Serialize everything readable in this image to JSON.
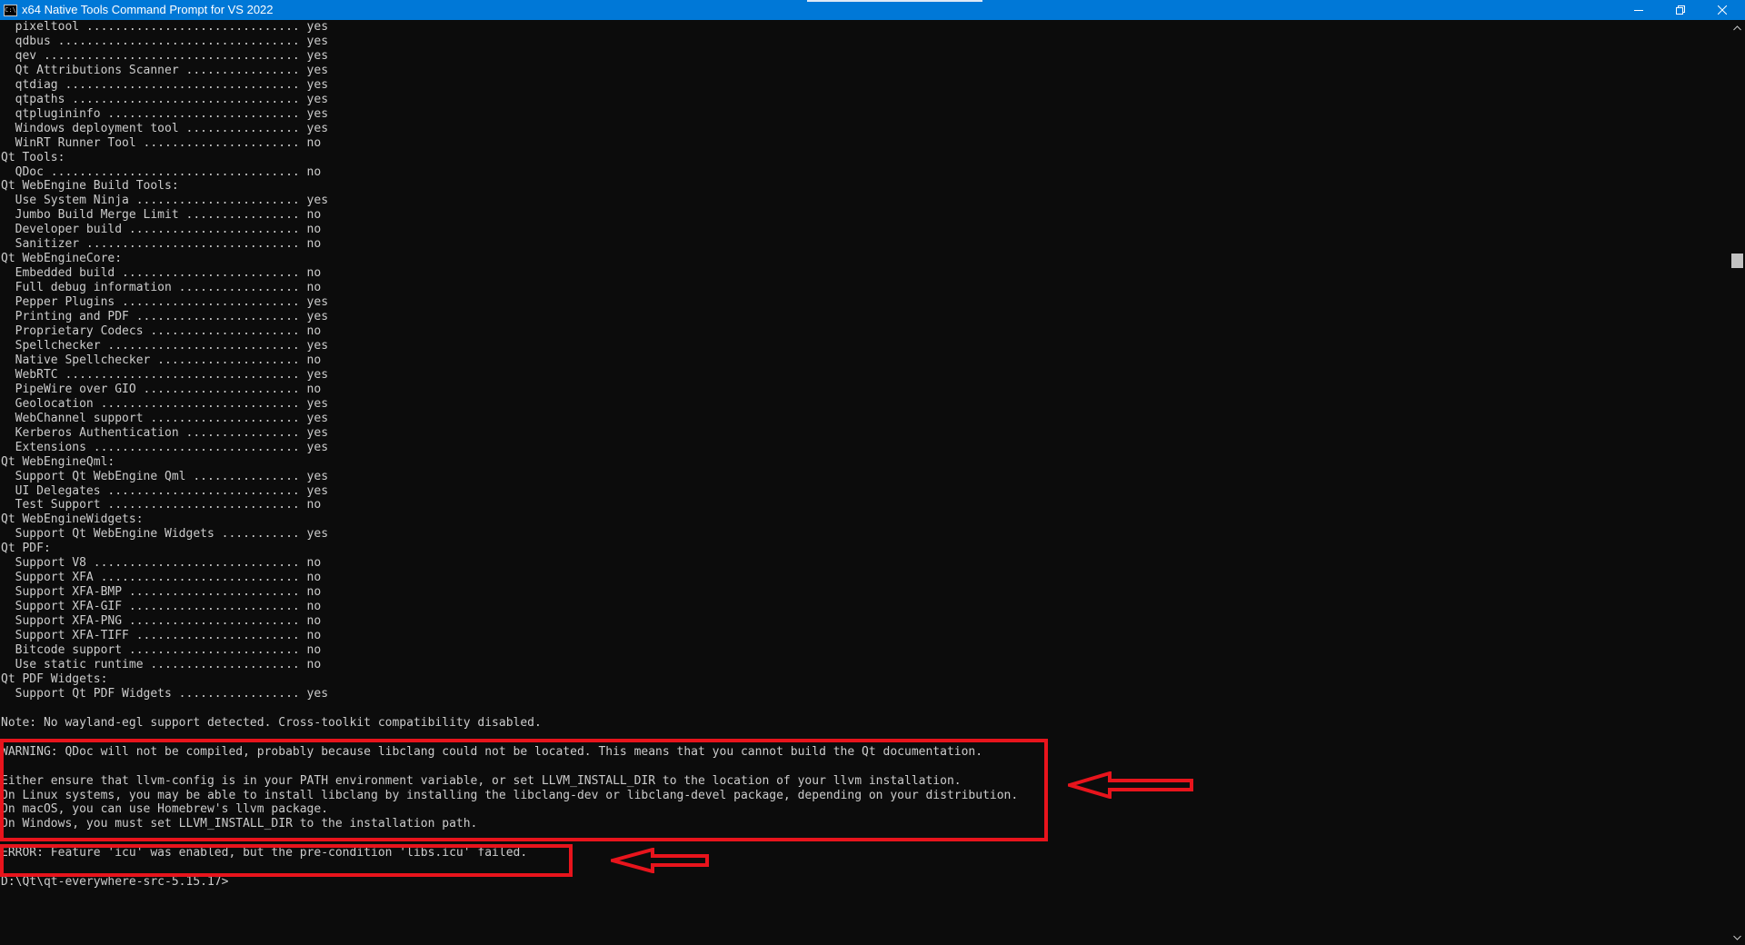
{
  "window": {
    "title": "x64 Native Tools Command Prompt for VS 2022",
    "icon": "cmd-console-icon",
    "icon_text": "C:\\",
    "accent_color": "#0078d7"
  },
  "controls": {
    "minimize": "minimize-icon",
    "maximize": "restore-icon",
    "close": "close-icon"
  },
  "console": {
    "lines": [
      "  pixeltool .............................. yes",
      "  qdbus .................................. yes",
      "  qev .................................... yes",
      "  Qt Attributions Scanner ................ yes",
      "  qtdiag ................................. yes",
      "  qtpaths ................................ yes",
      "  qtplugininfo ........................... yes",
      "  Windows deployment tool ................ yes",
      "  WinRT Runner Tool ...................... no",
      "Qt Tools:",
      "  QDoc ................................... no",
      "Qt WebEngine Build Tools:",
      "  Use System Ninja ....................... yes",
      "  Jumbo Build Merge Limit ................ no",
      "  Developer build ........................ no",
      "  Sanitizer .............................. no",
      "Qt WebEngineCore:",
      "  Embedded build ......................... no",
      "  Full debug information ................. no",
      "  Pepper Plugins ......................... yes",
      "  Printing and PDF ....................... yes",
      "  Proprietary Codecs ..................... no",
      "  Spellchecker ........................... yes",
      "  Native Spellchecker .................... no",
      "  WebRTC ................................. yes",
      "  PipeWire over GIO ...................... no",
      "  Geolocation ............................ yes",
      "  WebChannel support ..................... yes",
      "  Kerberos Authentication ................ yes",
      "  Extensions ............................. yes",
      "Qt WebEngineQml:",
      "  Support Qt WebEngine Qml ............... yes",
      "  UI Delegates ........................... yes",
      "  Test Support ........................... no",
      "Qt WebEngineWidgets:",
      "  Support Qt WebEngine Widgets ........... yes",
      "Qt PDF:",
      "  Support V8 ............................. no",
      "  Support XFA ............................ no",
      "  Support XFA-BMP ........................ no",
      "  Support XFA-GIF ........................ no",
      "  Support XFA-PNG ........................ no",
      "  Support XFA-TIFF ....................... no",
      "  Bitcode support ........................ no",
      "  Use static runtime ..................... no",
      "Qt PDF Widgets:",
      "  Support Qt PDF Widgets ................. yes",
      "",
      "Note: No wayland-egl support detected. Cross-toolkit compatibility disabled.",
      "",
      "WARNING: QDoc will not be compiled, probably because libclang could not be located. This means that you cannot build the Qt documentation.",
      "",
      "Either ensure that llvm-config is in your PATH environment variable, or set LLVM_INSTALL_DIR to the location of your llvm installation.",
      "On Linux systems, you may be able to install libclang by installing the libclang-dev or libclang-devel package, depending on your distribution.",
      "On macOS, you can use Homebrew's llvm package.",
      "On Windows, you must set LLVM_INSTALL_DIR to the installation path.",
      "",
      "ERROR: Feature 'icu' was enabled, but the pre-condition 'libs.icu' failed.",
      "",
      "D:\\Qt\\qt-everywhere-src-5.15.17>"
    ]
  },
  "annotations": {
    "color": "#e8141c",
    "boxes": [
      "warning-highlight-box",
      "error-highlight-box"
    ],
    "arrows": [
      "warning-pointer-arrow",
      "error-pointer-arrow"
    ]
  },
  "scrollbar": {
    "up": "scroll-up-arrow-icon",
    "down": "scroll-down-arrow-icon"
  }
}
